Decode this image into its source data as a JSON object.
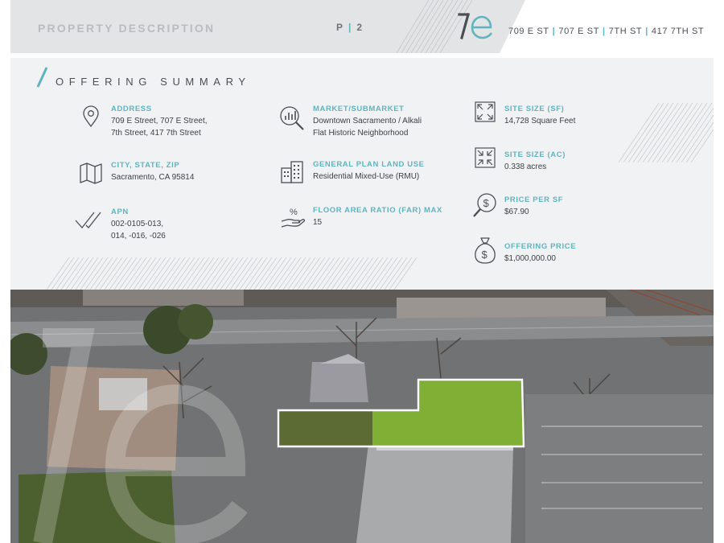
{
  "header": {
    "section_title": "PROPERTY DESCRIPTION",
    "page_prefix": "P",
    "page_number": "2",
    "addresses": [
      "709 E ST",
      "707 E ST",
      "7TH ST",
      "417 7TH ST"
    ],
    "logo_icon": "ae-monogram-logo"
  },
  "summary": {
    "heading": "OFFERING SUMMARY",
    "items": {
      "address": {
        "label": "ADDRESS",
        "lines": [
          "709 E Street, 707 E Street,",
          "7th Street, 417 7th Street"
        ],
        "icon": "map-pin-icon"
      },
      "city_state_zip": {
        "label": "CITY, STATE, ZIP",
        "lines": [
          "Sacramento, CA 95814"
        ],
        "icon": "folded-map-icon"
      },
      "apn": {
        "label": "APN",
        "lines": [
          "002-0105-013,",
          "014, -016, -026"
        ],
        "icon": "double-check-icon"
      },
      "market": {
        "label": "MARKET/SUBMARKET",
        "lines": [
          "Downtown Sacramento / Alkali",
          "Flat Historic Neighborhood"
        ],
        "icon": "magnifier-chart-icon"
      },
      "land_use": {
        "label": "GENERAL PLAN LAND USE",
        "lines": [
          "Residential Mixed-Use (RMU)"
        ],
        "icon": "buildings-icon"
      },
      "far": {
        "label": "FLOOR AREA RATIO (FAR) MAX",
        "lines": [
          "15"
        ],
        "icon": "hand-percent-icon"
      },
      "site_sf": {
        "label": "SITE SIZE (SF)",
        "lines": [
          "14,728 Square Feet"
        ],
        "icon": "expand-arrows-icon"
      },
      "site_ac": {
        "label": "SITE SIZE (AC)",
        "lines": [
          "0.338 acres"
        ],
        "icon": "collapse-arrows-icon"
      },
      "price_sf": {
        "label": "PRICE PER SF",
        "lines": [
          "$67.90"
        ],
        "icon": "dollar-magnifier-icon"
      },
      "offering_price": {
        "label": "OFFERING PRICE",
        "lines": [
          "$1,000,000.00"
        ],
        "icon": "money-bag-icon"
      }
    }
  },
  "colors": {
    "accent": "#5fb4bf",
    "text_dark": "#3c4147",
    "header_grey": "#e3e4e5",
    "panel_grey": "#f1f2f3"
  }
}
